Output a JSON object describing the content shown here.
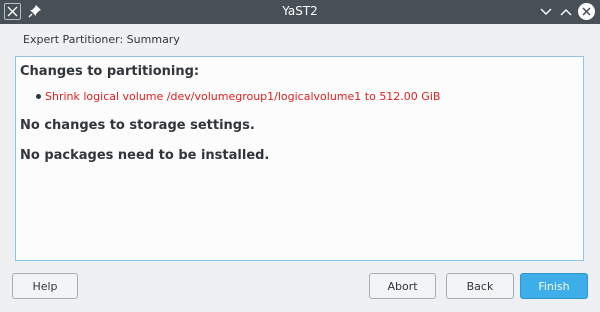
{
  "window": {
    "title": "YaST2"
  },
  "dialog": {
    "heading": "Expert Partitioner: Summary"
  },
  "summary": {
    "changes_heading": "Changes to partitioning:",
    "changes": [
      "Shrink logical volume /dev/volumegroup1/logicalvolume1 to 512.00 GiB"
    ],
    "storage_message": "No changes to storage settings.",
    "packages_message": "No packages need to be installed."
  },
  "buttons": {
    "help": "Help",
    "abort": "Abort",
    "back": "Back",
    "finish": "Finish"
  },
  "colors": {
    "accent": "#3daee9",
    "change_text": "#e02020"
  },
  "icons": {
    "app": "yast-app-icon",
    "pin": "pin-icon",
    "minimize": "chevron-down-icon",
    "maximize": "chevron-up-icon",
    "close": "close-icon"
  }
}
